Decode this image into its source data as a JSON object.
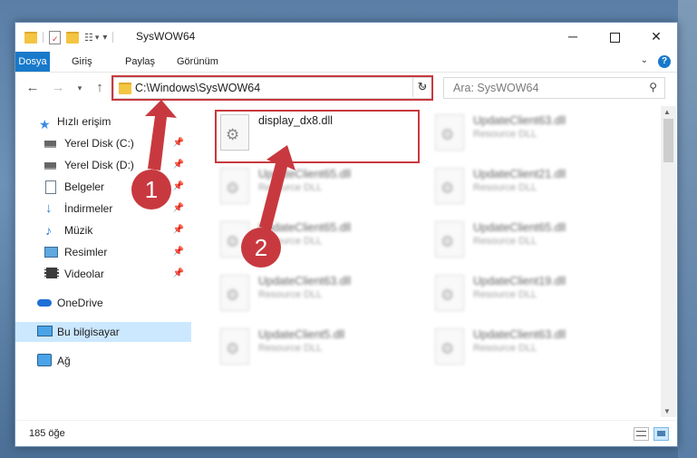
{
  "window": {
    "title": "SysWOW64",
    "minimize_icon": "minimize-icon",
    "maximize_icon": "maximize-icon",
    "close_icon": "close-icon"
  },
  "quick_access_toolbar": {
    "dropdown_glyph": "▾"
  },
  "ribbon": {
    "tabs": [
      {
        "label": "Dosya",
        "active": true
      },
      {
        "label": "Giriş"
      },
      {
        "label": "Paylaş"
      },
      {
        "label": "Görünüm"
      }
    ],
    "help_label": "?",
    "accent_color": "#1979ca"
  },
  "navigation": {
    "address": "C:\\Windows\\SysWOW64",
    "search_placeholder": "Ara: SysWOW64"
  },
  "nav_pane": {
    "quick_access": "Hızlı erişim",
    "items": [
      {
        "label": "Yerel Disk (C:)",
        "icon": "drive-icon",
        "pinned": true
      },
      {
        "label": "Yerel Disk (D:)",
        "icon": "drive-icon",
        "pinned": true
      },
      {
        "label": "Belgeler",
        "icon": "documents-icon",
        "pinned": true
      },
      {
        "label": "İndirmeler",
        "icon": "downloads-icon",
        "pinned": true
      },
      {
        "label": "Müzik",
        "icon": "music-icon",
        "pinned": true
      },
      {
        "label": "Resimler",
        "icon": "pictures-icon",
        "pinned": true
      },
      {
        "label": "Videolar",
        "icon": "videos-icon",
        "pinned": true
      }
    ],
    "onedrive": "OneDrive",
    "this_pc": "Bu bilgisayar",
    "network": "Ağ"
  },
  "files": [
    {
      "name": "display_dx8.dll",
      "type": "",
      "highlighted": true
    },
    {
      "name": "UpdateClient63.dll",
      "type": "Resource DLL"
    },
    {
      "name": "UpdateClient65.dll",
      "type": "Resource DLL"
    },
    {
      "name": "UpdateClient21.dll",
      "type": "Resource DLL"
    },
    {
      "name": "UpdateClient65.dll",
      "type": "Resource DLL"
    },
    {
      "name": "UpdateClient65.dll",
      "type": "Resource DLL"
    },
    {
      "name": "UpdateClient63.dll",
      "type": "Resource DLL"
    },
    {
      "name": "UpdateClient19.dll",
      "type": "Resource DLL"
    },
    {
      "name": "UpdateClient5.dll",
      "type": "Resource DLL"
    },
    {
      "name": "UpdateClient63.dll",
      "type": "Resource DLL"
    }
  ],
  "status": {
    "item_count": "185 öğe"
  },
  "annotations": {
    "step1": "1",
    "step2": "2",
    "color": "#c8393f"
  }
}
